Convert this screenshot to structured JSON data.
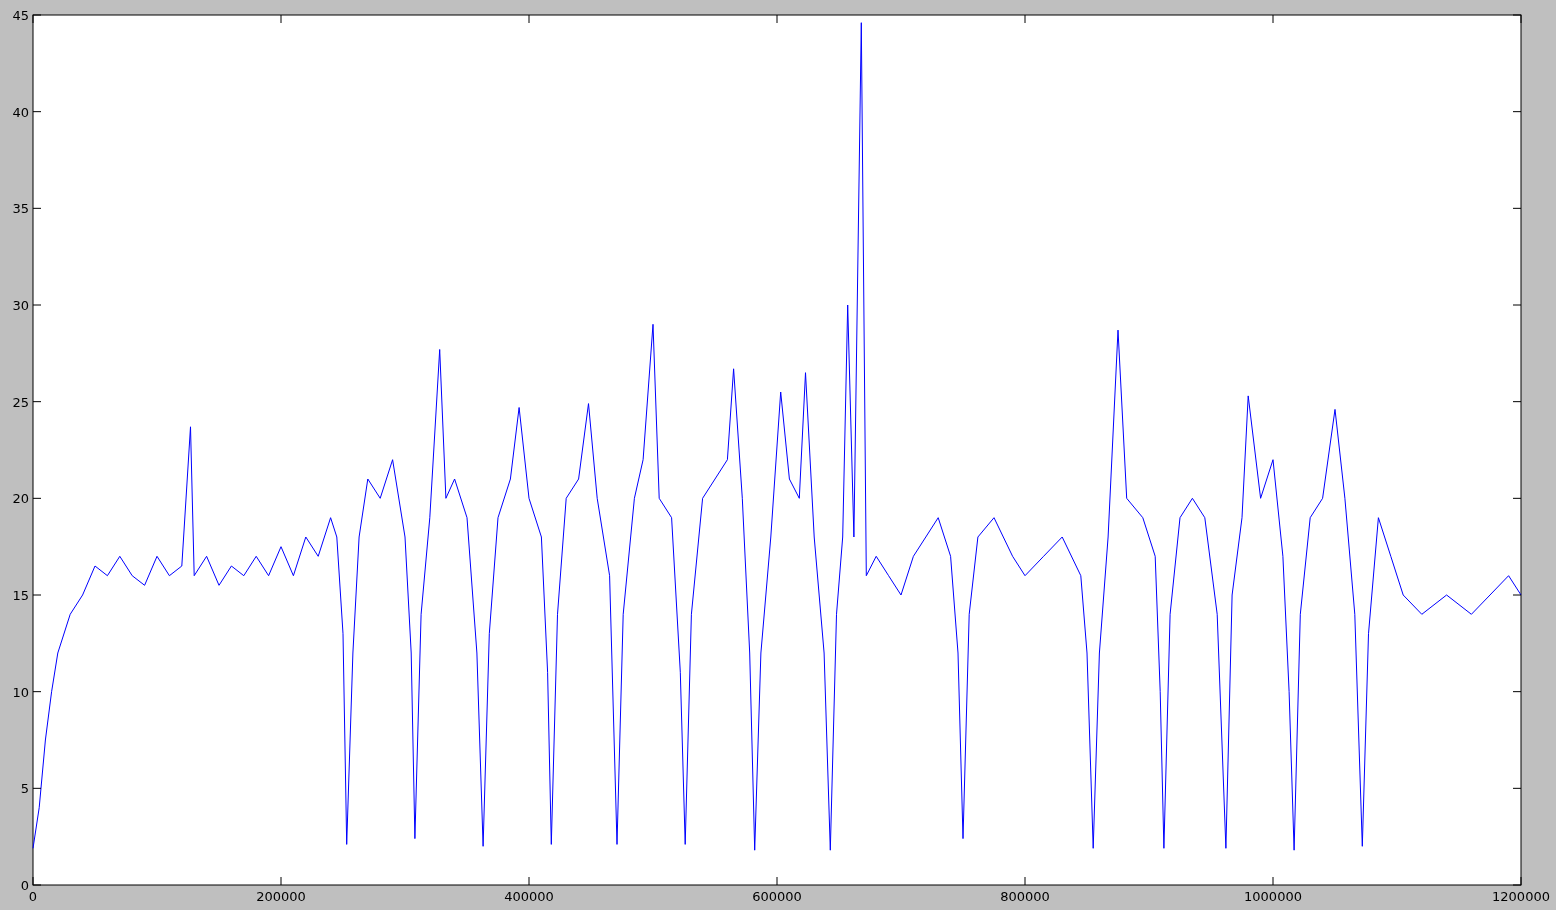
{
  "chart": {
    "chart_data": {
      "type": "line",
      "x": [
        0,
        5000,
        10000,
        15000,
        20000,
        30000,
        40000,
        50000,
        60000,
        70000,
        80000,
        90000,
        100000,
        110000,
        120000,
        127000,
        130000,
        140000,
        150000,
        160000,
        170000,
        180000,
        190000,
        200000,
        210000,
        220000,
        230000,
        240000,
        245000,
        250000,
        253000,
        258000,
        263000,
        270000,
        280000,
        290000,
        300000,
        305000,
        308000,
        313000,
        320000,
        328000,
        333000,
        340000,
        350000,
        358000,
        363000,
        368000,
        375000,
        385000,
        392000,
        400000,
        410000,
        415000,
        418000,
        423000,
        430000,
        440000,
        448000,
        455000,
        465000,
        471000,
        476000,
        485000,
        492000,
        500000,
        505000,
        515000,
        522000,
        526000,
        531000,
        540000,
        550000,
        560000,
        565000,
        572000,
        578000,
        582000,
        587000,
        595000,
        603000,
        610000,
        618000,
        623000,
        630000,
        638000,
        643000,
        648000,
        653000,
        657000,
        662000,
        668000,
        672000,
        680000,
        690000,
        700000,
        710000,
        720000,
        730000,
        740000,
        746000,
        750000,
        755000,
        762000,
        775000,
        790000,
        800000,
        815000,
        830000,
        845000,
        850000,
        855000,
        860000,
        867000,
        875000,
        882000,
        895000,
        905000,
        909000,
        912000,
        917000,
        925000,
        935000,
        945000,
        955000,
        962000,
        967000,
        975000,
        980000,
        990000,
        1000000,
        1008000,
        1013000,
        1017000,
        1022000,
        1030000,
        1040000,
        1050000,
        1058000,
        1066000,
        1072000,
        1077000,
        1085000,
        1095000,
        1105000,
        1120000,
        1140000,
        1160000,
        1175000,
        1190000,
        1200000
      ],
      "series": [
        {
          "color": "#0000ff",
          "values": [
            1.9,
            4,
            7.5,
            10,
            12,
            14,
            15,
            16.5,
            16,
            17,
            16,
            15.5,
            17,
            16,
            16.5,
            23.7,
            16,
            17,
            15.5,
            16.5,
            16,
            17,
            16,
            17.5,
            16,
            18,
            17,
            19,
            18,
            13,
            2.1,
            12,
            18,
            21,
            20,
            22,
            18,
            12,
            2.4,
            14,
            19,
            27.7,
            20,
            21,
            19,
            12,
            2.0,
            13,
            19,
            21,
            24.7,
            20,
            18,
            11,
            2.1,
            14,
            20,
            21,
            24.9,
            20,
            16,
            2.1,
            14,
            20,
            22,
            29.0,
            20,
            19,
            11,
            2.1,
            14,
            20,
            21,
            22,
            26.7,
            20,
            12,
            1.8,
            12,
            18,
            25.5,
            21,
            20,
            26.5,
            18,
            12,
            1.8,
            14,
            18,
            30.0,
            18,
            44.6,
            16,
            17,
            16,
            15,
            17,
            18,
            19,
            17,
            12,
            2.4,
            14,
            18,
            19,
            17,
            16,
            17,
            18,
            16,
            12,
            1.9,
            12,
            18,
            28.7,
            20,
            19,
            17,
            10,
            1.9,
            14,
            19,
            20,
            19,
            14,
            1.9,
            15,
            19,
            25.3,
            20,
            22,
            17,
            10,
            1.8,
            14,
            19,
            20,
            24.6,
            20,
            14,
            2.0,
            13,
            19,
            17,
            15,
            14,
            15,
            14,
            15,
            16,
            15
          ]
        }
      ],
      "xlim": [
        0,
        1200000
      ],
      "ylim": [
        0,
        45
      ],
      "xticks": [
        0,
        200000,
        400000,
        600000,
        800000,
        1000000,
        1200000
      ],
      "yticks": [
        0,
        5,
        10,
        15,
        20,
        25,
        30,
        35,
        40,
        45
      ]
    }
  }
}
